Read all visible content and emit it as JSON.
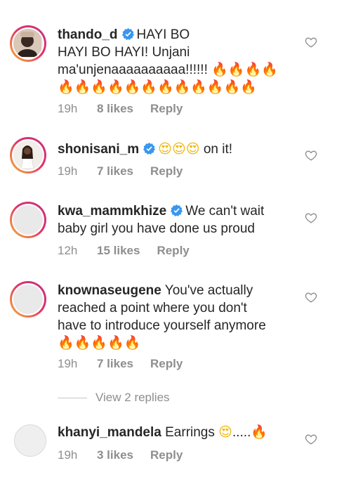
{
  "comments": [
    {
      "username": "thando_d",
      "verified": true,
      "text_lines": [
        "HAYI BO",
        "HAYI BO HAYI! Unjani",
        "ma'unjenaaaaaaaaaa!!!!!!"
      ],
      "emojis_line3": "🔥🔥🔥🔥",
      "emojis_line4": "🔥🔥🔥🔥🔥🔥🔥🔥🔥🔥🔥🔥",
      "time": "19h",
      "likes": "8 likes",
      "reply": "Reply",
      "avatar_style": "story-ring"
    },
    {
      "username": "shonisani_m",
      "verified": true,
      "emojis": "😍😍😍",
      "text": "on it!",
      "time": "19h",
      "likes": "7 likes",
      "reply": "Reply",
      "avatar_style": "story-ring"
    },
    {
      "username": "kwa_mammkhize",
      "verified": true,
      "text_line1": "We can't wait",
      "text_line2": "baby girl you have done us proud",
      "time": "12h",
      "likes": "15 likes",
      "reply": "Reply",
      "avatar_style": "story-ring"
    },
    {
      "username": "knownaseugene",
      "verified": false,
      "text_line1": "You've actually",
      "text_line2": "reached a point where you don't",
      "text_line3": "have to introduce yourself anymore",
      "emojis": "🔥🔥🔥🔥🔥",
      "time": "19h",
      "likes": "7 likes",
      "reply": "Reply",
      "avatar_style": "story-ring"
    },
    {
      "username": "khanyi_mandela",
      "verified": false,
      "text": "Earrings",
      "emojis_a": "😍",
      "dots": ".....",
      "emojis_b": "🔥",
      "time": "19h",
      "likes": "3 likes",
      "reply": "Reply",
      "avatar_style": "plain"
    }
  ],
  "view_replies": "View 2 replies",
  "colors": {
    "text": "#262626",
    "meta": "#8e8e8e",
    "verified": "#3897f0",
    "ring_start": "#f7b733",
    "ring_end": "#c13584"
  },
  "icons": [
    "verified-badge-icon",
    "heart-outline-icon"
  ]
}
